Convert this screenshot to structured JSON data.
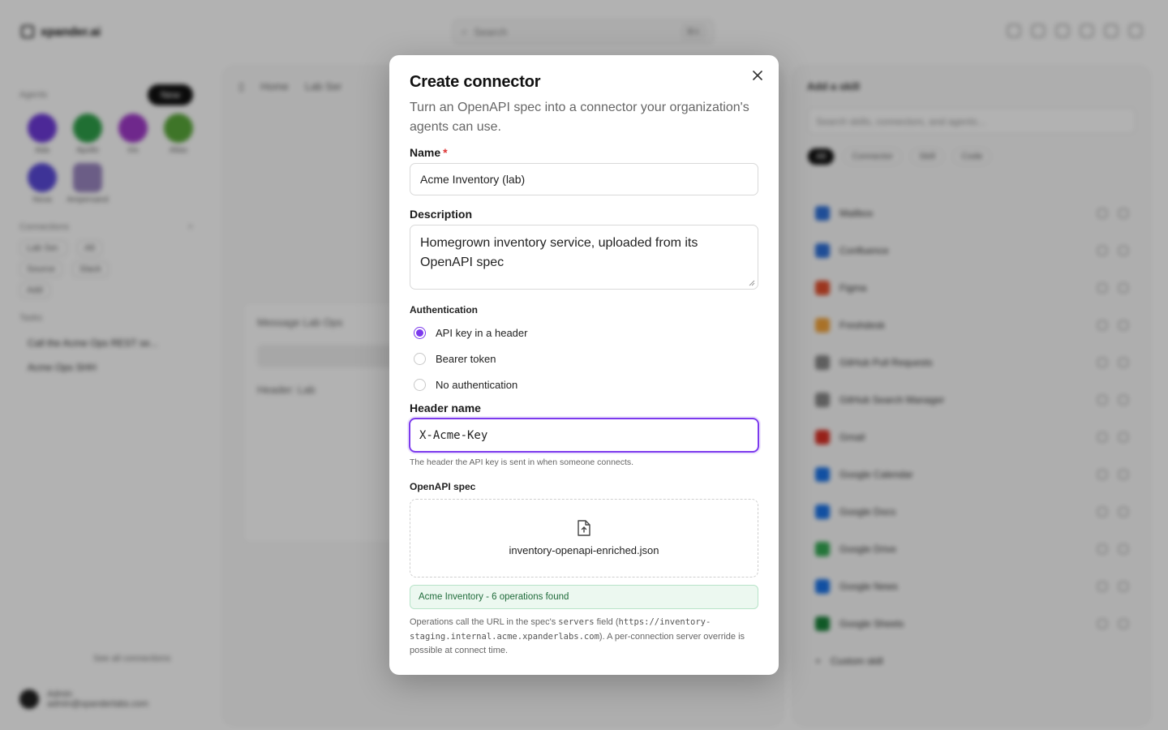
{
  "background": {
    "app_name": "xpander.ai",
    "search_placeholder": "Search",
    "search_kbd": "⌘K",
    "sidebar": {
      "agents_label": "Agents",
      "new_label": "New",
      "agents": [
        "Ada",
        "Apollo",
        "Iris",
        "Atlas",
        "Nova",
        "Ampersand"
      ],
      "connections_label": "Connections",
      "chips": [
        "Lab Ser.",
        "Alt"
      ],
      "chips2": [
        "Source",
        "Slack"
      ],
      "chip3": "Add",
      "tasks_label": "Tasks",
      "tasks": [
        "Call the Acme Ops REST se...",
        "Acme Ops SHH"
      ],
      "see_all": "See all connections",
      "user_name": "Admin",
      "user_email": "admin@xpanderlabs.com"
    },
    "main": {
      "crumbs": [
        "Home",
        "Lab Ser"
      ],
      "card_title": "Message Lab Ops",
      "card_line": "Header: Lab"
    },
    "right": {
      "title": "Add a skill",
      "search_placeholder": "Search skills, connectors, and agents...",
      "filters": [
        "All",
        "Connector",
        "Skill",
        "Code"
      ],
      "tools": [
        "Mailbox",
        "Confluence",
        "Figma",
        "Freshdesk",
        "GitHub Pull Requests",
        "GitHub Search Manager",
        "Gmail",
        "Google Calendar",
        "Google Docs",
        "Google Drive",
        "Google News",
        "Google Sheets"
      ],
      "custom": "Custom skill"
    }
  },
  "modal": {
    "title": "Create connector",
    "subtitle": "Turn an OpenAPI spec into a connector your organization's agents can use.",
    "name_label": "Name",
    "required_mark": "*",
    "name_value": "Acme Inventory (lab)",
    "description_label": "Description",
    "description_value": "Homegrown inventory service, uploaded from its OpenAPI spec",
    "auth_label": "Authentication",
    "auth_options": [
      {
        "label": "API key in a header",
        "selected": true
      },
      {
        "label": "Bearer token",
        "selected": false
      },
      {
        "label": "No authentication",
        "selected": false
      }
    ],
    "header_name_label": "Header name",
    "header_name_value": "X-Acme-Key",
    "header_hint": "The header the API key is sent in when someone connects.",
    "spec_label": "OpenAPI spec",
    "spec_file": "inventory-openapi-enriched.json",
    "spec_status": "Acme Inventory - 6 operations found",
    "note_1": "Operations call the URL in the spec's ",
    "note_code_1": "servers",
    "note_2": " field (",
    "note_code_2": "https://inventory-staging.internal.acme.xpanderlabs.com",
    "note_3": "). A per-connection server override is possible at connect time."
  },
  "colors": {
    "accent": "#7c3aed",
    "success_bg": "#ecf8f0",
    "success_text": "#1f6b3a",
    "required": "#dd3333"
  }
}
